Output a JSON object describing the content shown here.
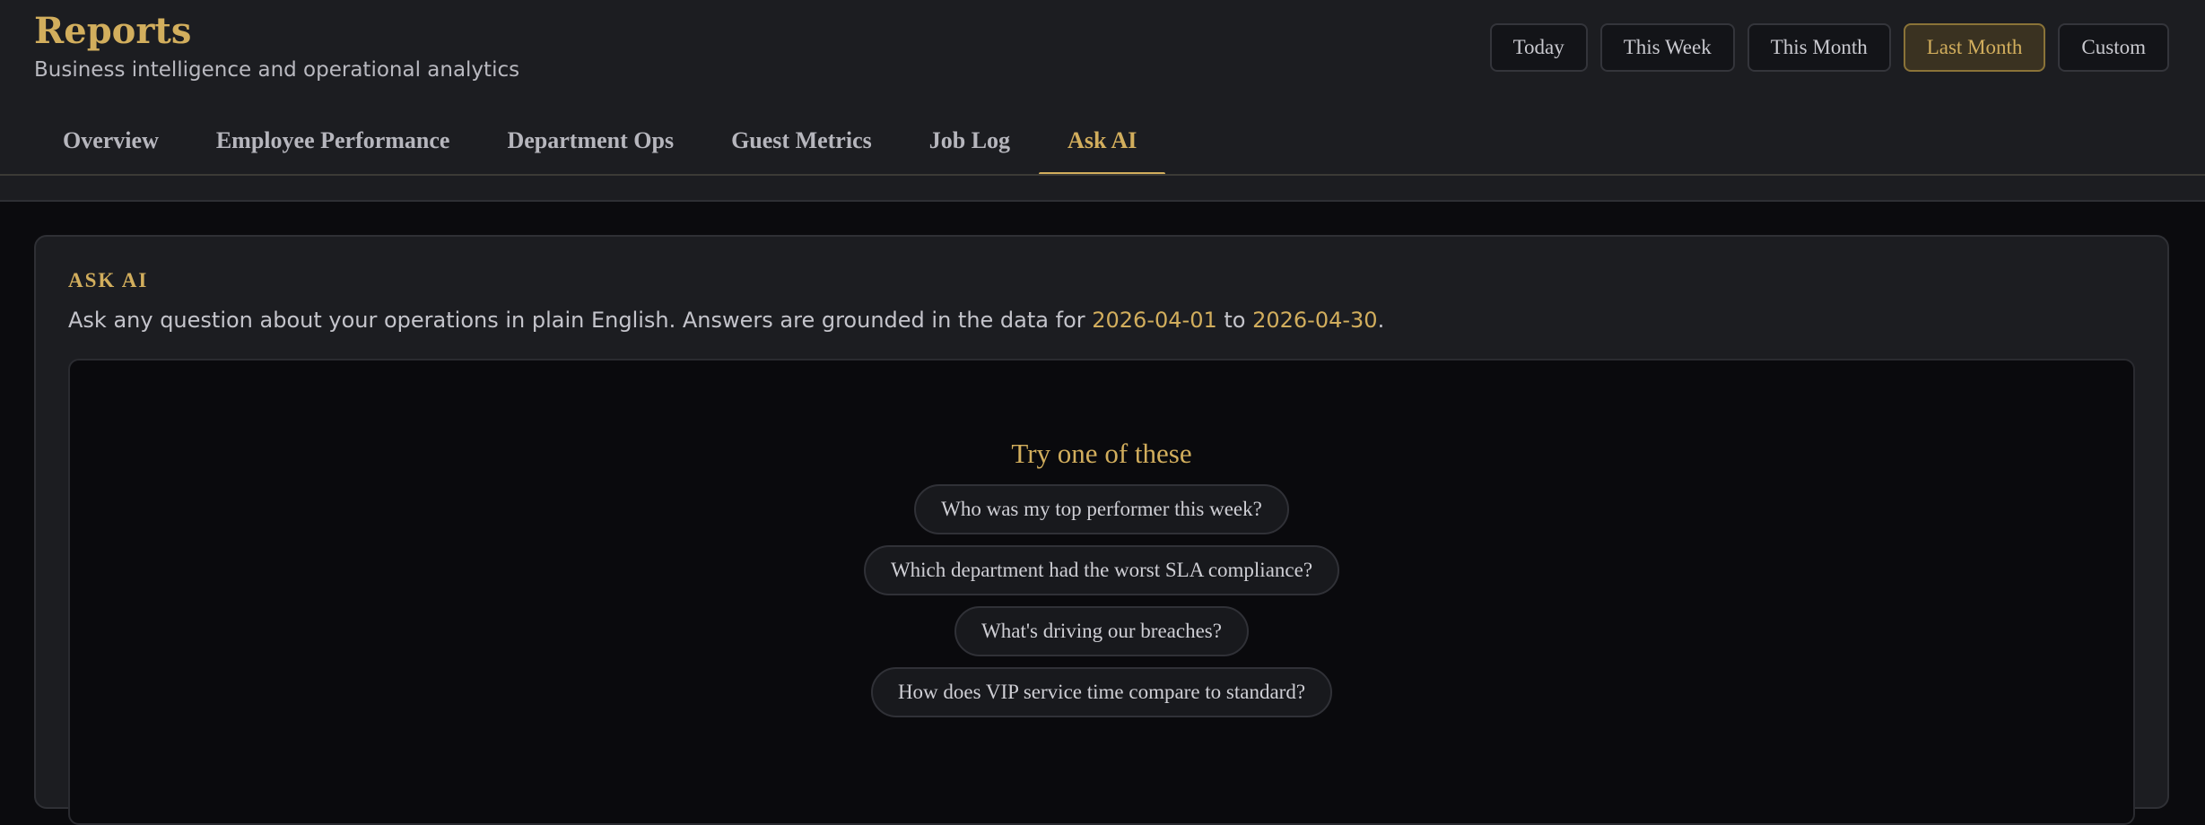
{
  "header": {
    "title": "Reports",
    "subtitle": "Business intelligence and operational analytics"
  },
  "date_range": {
    "options": [
      "Today",
      "This Week",
      "This Month",
      "Last Month",
      "Custom"
    ],
    "selected": "Last Month"
  },
  "tabs": [
    {
      "label": "Overview"
    },
    {
      "label": "Employee Performance"
    },
    {
      "label": "Department Ops"
    },
    {
      "label": "Guest Metrics"
    },
    {
      "label": "Job Log"
    },
    {
      "label": "Ask AI"
    }
  ],
  "active_tab": "Ask AI",
  "ask_ai": {
    "section_label": "ASK AI",
    "description_prefix": "Ask any question about your operations in plain English. Answers are grounded in the data for ",
    "date_from": "2026-04-01",
    "description_middle": " to ",
    "date_to": "2026-04-30",
    "description_suffix": ".",
    "suggestions_title": "Try one of these",
    "suggestions": [
      "Who was my top performer this week?",
      "Which department had the worst SLA compliance?",
      "What's driving our breaches?",
      "How does VIP service time compare to standard?"
    ]
  },
  "colors": {
    "accent": "#d2ae5d",
    "background": "#0b0b0e",
    "panel": "#1c1d21"
  }
}
